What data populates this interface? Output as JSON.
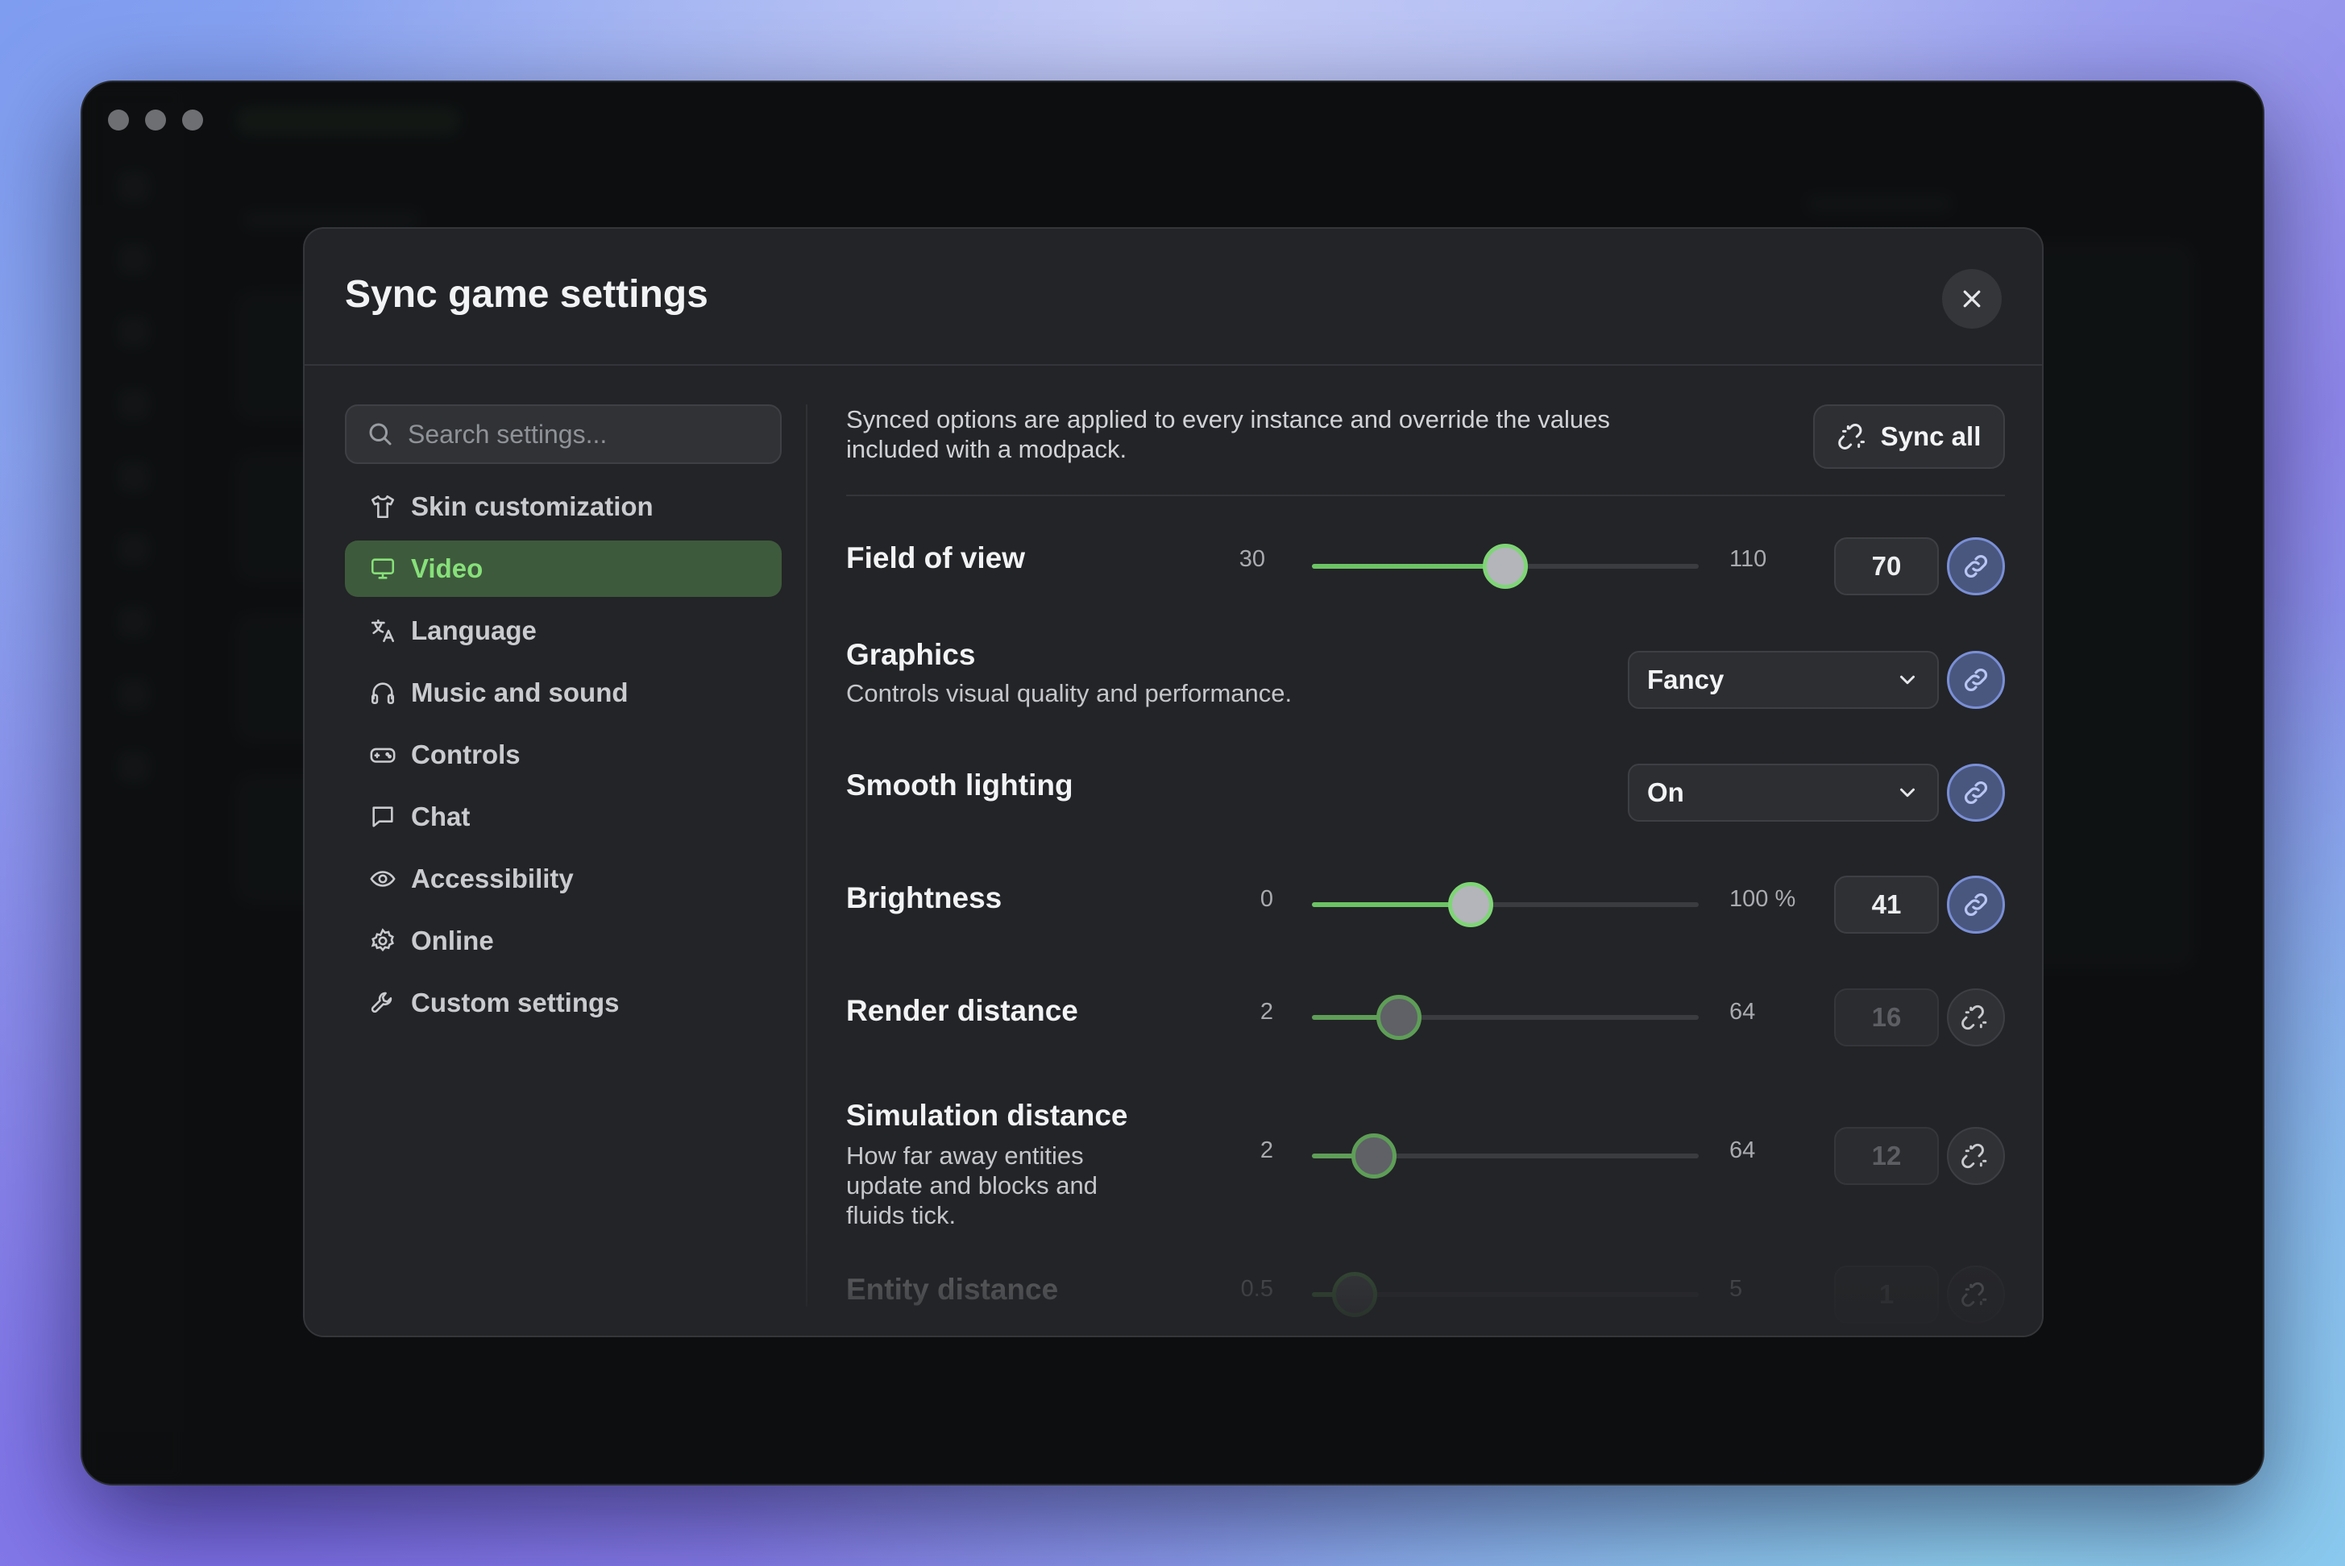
{
  "modal": {
    "title": "Sync game settings",
    "close_icon": "close-icon"
  },
  "search": {
    "placeholder": "Search settings...",
    "icon": "search-icon"
  },
  "nav": {
    "items": [
      {
        "label": "Skin customization",
        "icon": "shirt-icon",
        "active": false
      },
      {
        "label": "Video",
        "icon": "monitor-icon",
        "active": true
      },
      {
        "label": "Language",
        "icon": "translate-icon",
        "active": false
      },
      {
        "label": "Music and sound",
        "icon": "headphones-icon",
        "active": false
      },
      {
        "label": "Controls",
        "icon": "gamepad-icon",
        "active": false
      },
      {
        "label": "Chat",
        "icon": "chat-bubble-icon",
        "active": false
      },
      {
        "label": "Accessibility",
        "icon": "eye-icon",
        "active": false
      },
      {
        "label": "Online",
        "icon": "gear-icon",
        "active": false
      },
      {
        "label": "Custom settings",
        "icon": "wrench-icon",
        "active": false
      }
    ]
  },
  "intro": "Synced options are applied to every instance and override the values included with a modpack.",
  "sync_all": {
    "label": "Sync all",
    "icon": "unlink-icon"
  },
  "settings": {
    "fov": {
      "label": "Field of view",
      "min": "30",
      "max": "110",
      "value": "70",
      "fraction": 0.5,
      "synced": true
    },
    "graphics": {
      "label": "Graphics",
      "description": "Controls visual quality and performance.",
      "value": "Fancy",
      "synced": true
    },
    "smooth_lighting": {
      "label": "Smooth lighting",
      "value": "On",
      "synced": true
    },
    "brightness": {
      "label": "Brightness",
      "min": "0",
      "max": "100 %",
      "value": "41",
      "fraction": 0.41,
      "synced": true
    },
    "render_distance": {
      "label": "Render distance",
      "min": "2",
      "max": "64",
      "value": "16",
      "fraction": 0.226,
      "synced": false
    },
    "simulation_distance": {
      "label": "Simulation distance",
      "description": "How far away entities update and blocks and fluids tick.",
      "min": "2",
      "max": "64",
      "value": "12",
      "fraction": 0.161,
      "synced": false
    },
    "entity_distance": {
      "label": "Entity distance",
      "min": "0.5",
      "max": "5",
      "value": "1",
      "fraction": 0.111,
      "synced": false
    }
  },
  "colors": {
    "accent_green": "#6cc464",
    "active_nav_bg": "#3e5a3c",
    "link_blue": "#7a8fd6"
  }
}
